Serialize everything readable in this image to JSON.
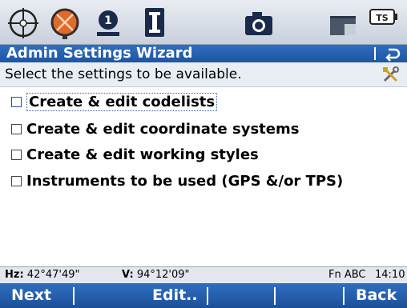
{
  "icons": {
    "top_bar": [
      "crosshair-target-icon",
      "prism-icon",
      "numbered-pin-icon",
      "text-cursor-icon",
      "camera-icon",
      "memory-card-icon",
      "ts-instrument-icon"
    ],
    "pin_number": "1",
    "ts_label": "TS",
    "title_bar": "back-return-icon",
    "instruction": "tools-icon"
  },
  "header": {
    "title": "Admin Settings Wizard"
  },
  "instruction": "Select the settings to be available.",
  "items": [
    {
      "label": "Create & edit codelists",
      "checked": false,
      "focused": true
    },
    {
      "label": "Create & edit coordinate systems",
      "checked": false,
      "focused": false
    },
    {
      "label": "Create & edit working styles",
      "checked": false,
      "focused": false
    },
    {
      "label": "Instruments to be used (GPS &/or TPS)",
      "checked": false,
      "focused": false
    }
  ],
  "status": {
    "hz_label": "Hz:",
    "hz_value": "42°47'49\"",
    "v_label": "V:",
    "v_value": "94°12'09\"",
    "mode": "Fn ABC",
    "time": "14:10"
  },
  "softkeys": {
    "next": "Next",
    "edit": "Edit..",
    "back": "Back"
  },
  "colors": {
    "accent": "#1f55a3",
    "prism": "#e06a2a"
  }
}
